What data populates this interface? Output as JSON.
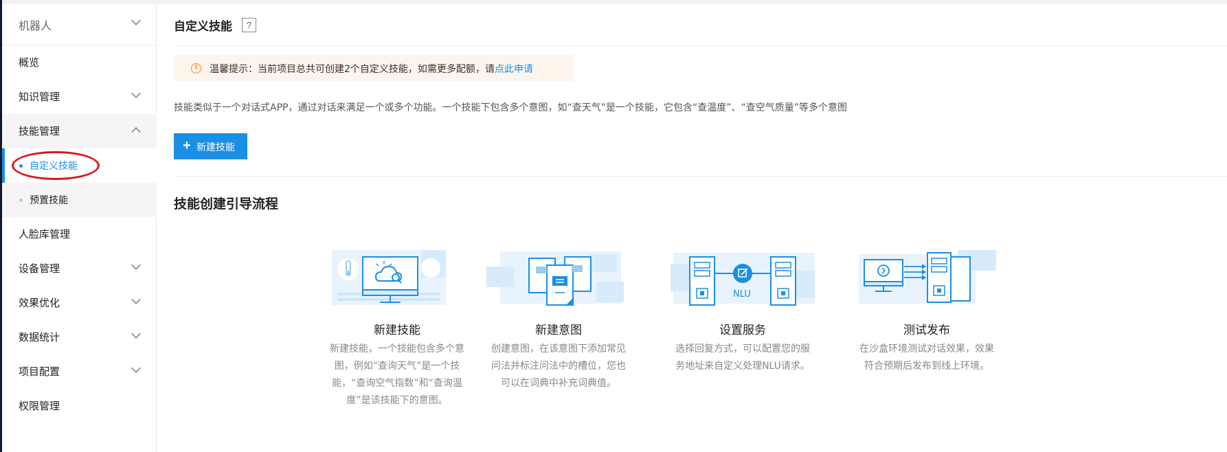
{
  "sidebar": {
    "header": "机器人",
    "items": [
      {
        "label": "概览"
      },
      {
        "label": "知识管理"
      },
      {
        "label": "技能管理"
      },
      {
        "label": "自定义技能"
      },
      {
        "label": "预置技能"
      },
      {
        "label": "人脸库管理"
      },
      {
        "label": "设备管理"
      },
      {
        "label": "效果优化"
      },
      {
        "label": "数据统计"
      },
      {
        "label": "项目配置"
      },
      {
        "label": "权限管理"
      }
    ]
  },
  "main": {
    "title": "自定义技能",
    "help": "?",
    "notice": {
      "icon": "warning-circle-icon",
      "prefix": "温馨提示：当前项目总共可创建2个自定义技能，如需更多配额，请",
      "link": "点此申请"
    },
    "description": "技能类似于一个对话式APP，通过对话来满足一个或多个功能。一个技能下包含多个意图，如“查天气”是一个技能，它包含“查温度”、“查空气质量”等多个意图",
    "new_button": {
      "plus": "+",
      "label": "新建技能"
    },
    "guide_title": "技能创建引导流程",
    "steps": [
      {
        "title": "新建技能",
        "text": "新建技能，一个技能包含多个意图，例如“查询天气”是一个技能，“查询空气指数”和“查询温度”是该技能下的意图。",
        "icon": "monitor-weather-icon"
      },
      {
        "title": "新建意图",
        "text": "创建意图，在该意图下添加常见问法并标注问法中的槽位，您也可以在词典中补充词典值。",
        "icon": "chat-cards-icon"
      },
      {
        "title": "设置服务",
        "text": "选择回复方式，可以配置您的服务地址来自定义处理NLU请求。",
        "icon": "server-nlu-icon",
        "badge": "NLU"
      },
      {
        "title": "测试发布",
        "text": "在沙盒环境测试对话效果，效果符合预期后发布到线上环境。",
        "icon": "test-publish-icon"
      }
    ]
  },
  "colors": {
    "accent": "#1a8fe3",
    "notice_bg": "#fdf5ec",
    "warning": "#f08a2e",
    "highlight_ring": "#d9181d"
  }
}
